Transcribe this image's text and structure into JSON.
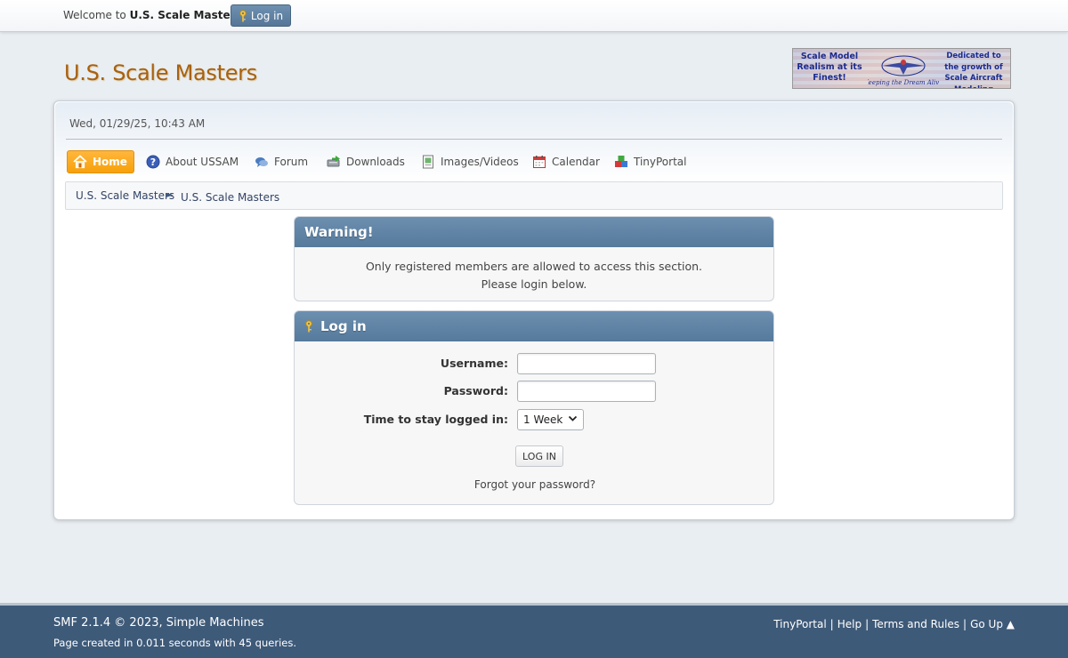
{
  "top_bar": {
    "welcome_prefix": "Welcome to ",
    "site_name": "U.S. Scale Masters",
    "welcome_suffix": ".",
    "login_label": "Log in"
  },
  "header": {
    "title": "U.S. Scale Masters",
    "banner": {
      "left_text": "Scale Model Realism at its Finest!",
      "mid_text": "Keeping the Dream Alive",
      "right_text": "Dedicated to the growth of Scale Aircraft Modeling"
    }
  },
  "datetime": "Wed, 01/29/25, 10:43 AM",
  "nav": {
    "items": [
      {
        "label": "Home",
        "icon": "home-icon",
        "active": true
      },
      {
        "label": "About USSAM",
        "icon": "help-icon"
      },
      {
        "label": "Forum",
        "icon": "forum-icon"
      },
      {
        "label": "Downloads",
        "icon": "downloads-icon"
      },
      {
        "label": "Images/Videos",
        "icon": "images-icon"
      },
      {
        "label": "Calendar",
        "icon": "calendar-icon"
      },
      {
        "label": "TinyPortal",
        "icon": "tinyportal-icon"
      }
    ]
  },
  "breadcrumb": {
    "items": [
      "U.S. Scale Masters",
      "U.S. Scale Masters"
    ],
    "separator": "►"
  },
  "warning": {
    "title": "Warning!",
    "line1": "Only registered members are allowed to access this section.",
    "line2": "Please login below."
  },
  "login": {
    "title": "Log in",
    "username_label": "Username:",
    "username_value": "",
    "password_label": "Password:",
    "password_value": "",
    "stay_label": "Time to stay logged in:",
    "stay_value": "1 Week",
    "submit_label": "LOG IN",
    "forgot_label": "Forgot your password?"
  },
  "footer": {
    "copyright": "SMF 2.1.4 © 2023, Simple Machines",
    "stats": "Page created in 0.011 seconds with 45 queries.",
    "links": [
      "TinyPortal",
      "Help",
      "Terms and Rules",
      "Go Up ▲"
    ],
    "link_separator": "|"
  },
  "colors": {
    "accent": "#f7a10a",
    "panel_header": "#5f84a6",
    "footer": "#3e5a79",
    "title": "#a8610f"
  }
}
